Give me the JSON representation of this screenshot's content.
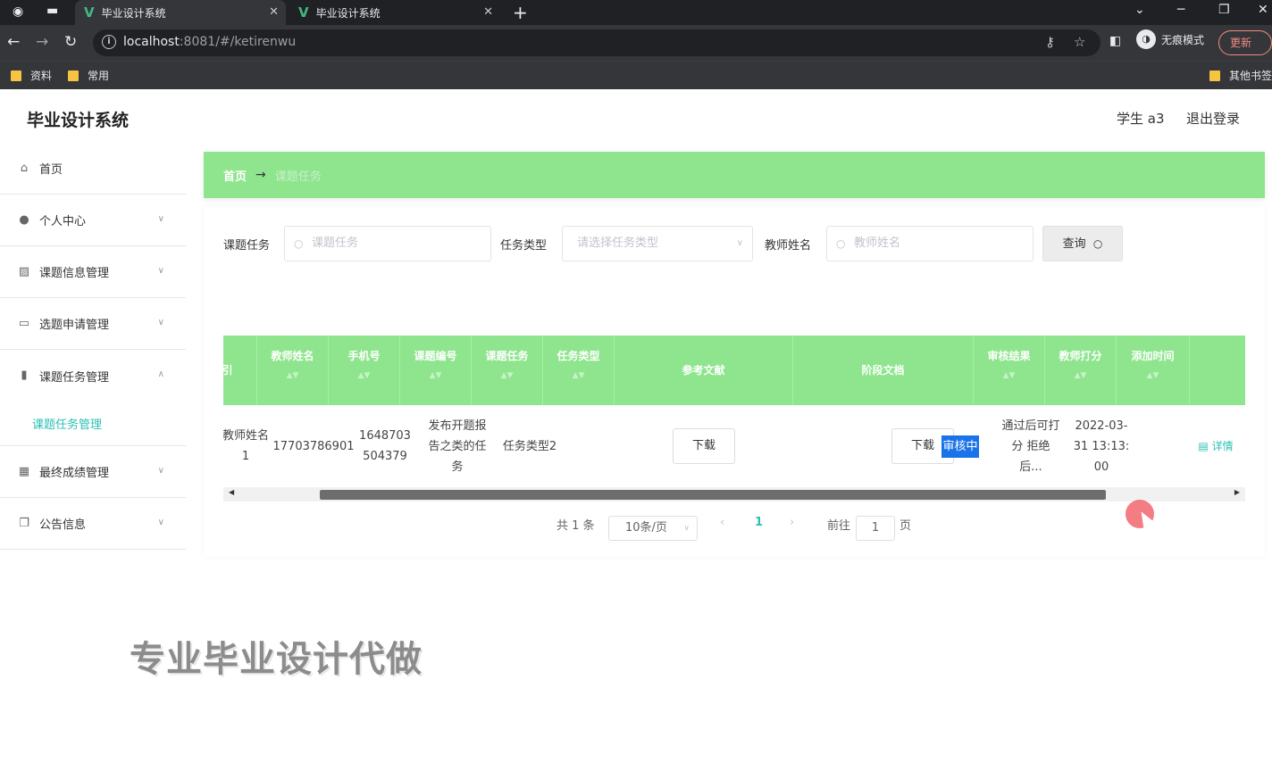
{
  "browser": {
    "tabs": [
      {
        "title": "毕业设计系统",
        "active": true
      },
      {
        "title": "毕业设计系统",
        "active": false
      }
    ],
    "url_host": "localhost",
    "url_rest": ":8081/#/ketirenwu",
    "incognito_label": "无痕模式",
    "update_label": "更新",
    "bookmarks": [
      "资料",
      "常用"
    ],
    "other_bookmarks": "其他书签"
  },
  "header": {
    "app_title": "毕业设计系统",
    "user": "学生 a3",
    "logout": "退出登录"
  },
  "sidebar": {
    "items": [
      {
        "label": "首页",
        "icon": "home-icon"
      },
      {
        "label": "个人中心",
        "icon": "user-icon"
      },
      {
        "label": "课题信息管理",
        "icon": "chart-icon"
      },
      {
        "label": "选题申请管理",
        "icon": "message-icon"
      },
      {
        "label": "课题任务管理",
        "icon": "bar-icon"
      },
      {
        "label": "最终成绩管理",
        "icon": "grid-icon"
      },
      {
        "label": "公告信息",
        "icon": "copy-icon"
      }
    ],
    "sub_item": "课题任务管理"
  },
  "breadcrumb": {
    "home": "首页",
    "arrow": "→",
    "current": "课题任务"
  },
  "filters": {
    "task_label": "课题任务",
    "task_placeholder": "课题任务",
    "type_label": "任务类型",
    "type_placeholder": "请选择任务类型",
    "teacher_label": "教师姓名",
    "teacher_placeholder": "教师姓名",
    "query_button": "查询"
  },
  "table": {
    "columns": [
      "索引",
      "教师姓名",
      "手机号",
      "课题编号",
      "课题任务",
      "任务类型",
      "参考文献",
      "阶段文档",
      "审核结果",
      "教师打分",
      "添加时间"
    ],
    "row": {
      "teacher": "教师姓名1",
      "phone": "17703786901",
      "topic_no": "1648703504379",
      "task": "发布开题报告之类的任务",
      "type": "任务类型2",
      "ref_btn": "下载",
      "doc_btn": "下载",
      "status": "审核中",
      "score": "通过后可打分 拒绝后...",
      "time": "2022-03-31 13:13:00",
      "detail": "详情"
    }
  },
  "pagination": {
    "total": "共 1 条",
    "page_size": "10条/页",
    "current": "1",
    "goto_label": "前往",
    "goto_value": "1",
    "page_suffix": "页"
  },
  "overlay": {
    "watermark": "专业毕业设计代做"
  }
}
